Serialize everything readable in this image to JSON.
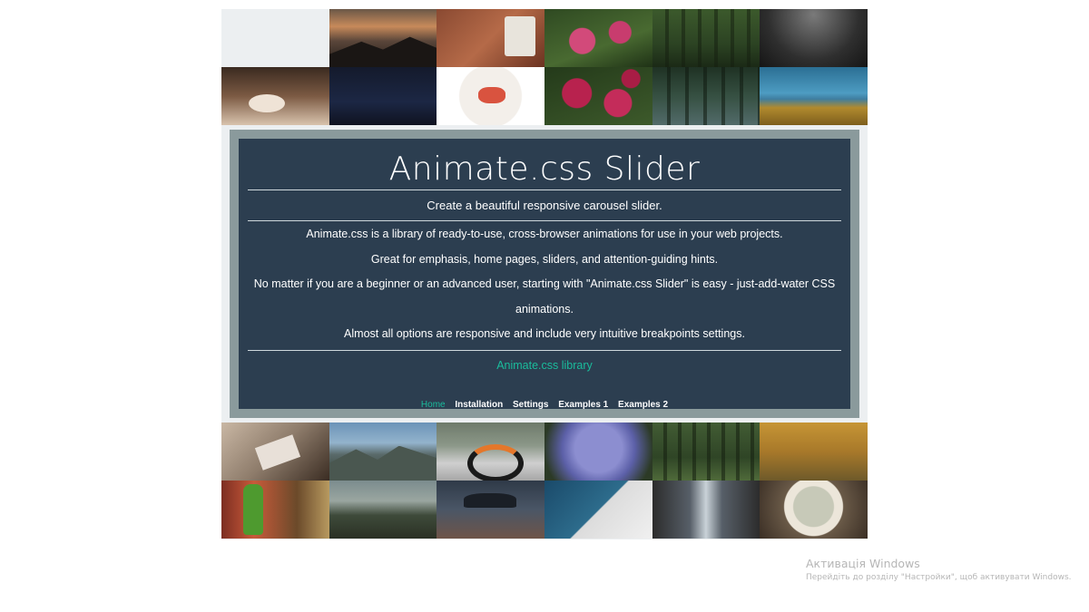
{
  "slider": {
    "title": "Animate.css Slider",
    "subtitle": "Create a beautiful responsive carousel slider.",
    "paragraphs": [
      "Animate.css is a library of ready-to-use, cross-browser animations for use in your web projects.",
      "Great for emphasis, home pages, sliders, and attention-guiding hints.",
      "No matter if you are a beginner or an advanced user, starting with \"Animate.css Slider\" is easy - just-add-water CSS animations.",
      "Almost all options are responsive and include very intuitive breakpoints settings."
    ],
    "library_link": "Animate.css library",
    "nav": [
      "Home",
      "Installation",
      "Settings",
      "Examples 1",
      "Examples 2"
    ],
    "active_nav": "Home",
    "accent_color": "#1abc9c",
    "panel_color": "#2c3e50"
  },
  "windows_activation": {
    "title": "Активація Windows",
    "subtitle": "Перейдіть до розділу \"Настройки\", щоб активувати Windows."
  }
}
